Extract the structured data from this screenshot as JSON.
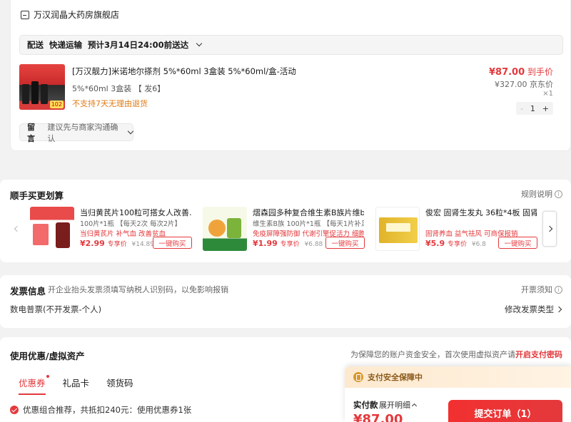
{
  "shop": {
    "name": "万汉润晶大药房旗舰店"
  },
  "shipping": {
    "label": "配送",
    "method": "快递运输",
    "eta": "预计3月14日24:00前送达"
  },
  "product": {
    "title": "[万汉靓力]米诺地尔搽剂 5%*60ml 3盒装 5%*60ml/盒-活动",
    "spec": "5%*60ml 3盒装 【 发6】",
    "return_policy": "不支持7天无理由退货",
    "price": "¥87.00",
    "price_suffix": "到手价",
    "jd_price": "¥327.00 京东价",
    "qty_x": "×1",
    "qty": "1",
    "image_tag": "102"
  },
  "memo": {
    "label": "留言",
    "placeholder": "建议先与商家沟通确认"
  },
  "bundle": {
    "title": "顺手买更划算",
    "rules": "规则说明",
    "items": [
      {
        "title": "当归黄芪片100粒可搭女人改善…",
        "sub": "100片*1瓶 【每天2次 每次2片】",
        "tag": "当归黄芪片 补气血 改善贫血",
        "price": "¥2.99",
        "price_label": "专享价",
        "orig": "¥14.89",
        "buy": "一键购买"
      },
      {
        "title": "熠森园多种复合维生素B族片维b…",
        "sub": "维生素B族 100片*1瓶 【每天1片补足B",
        "tag": "免疫屏障强防御 代谢引擎促活力 细胞修",
        "price": "¥1.99",
        "price_label": "专享价",
        "orig": "¥6.88",
        "buy": "一键购买"
      },
      {
        "title": "俊宏 固肾生发丸 36粒*4板 固肾…",
        "sub": "",
        "tag": "固肾养血 益气祛风 可商保报销",
        "price": "¥5.9",
        "price_label": "专享价",
        "orig": "¥6.8",
        "buy": "一键购买"
      }
    ]
  },
  "invoice": {
    "title": "发票信息",
    "hint": "开企业抬头发票须填写纳税人识别码，以免影响报销",
    "notice": "开票须知",
    "type": "数电普票(不开发票-个人)",
    "change": "修改发票类型"
  },
  "coupon": {
    "title": "使用优惠/虚拟资产",
    "note_prefix": "为保障您的账户资金安全，首次使用虚拟资产请",
    "note_link": "开启支付密码",
    "tabs": [
      "优惠券",
      "礼品卡",
      "领货码"
    ],
    "combo": "优惠组合推荐，共抵扣240元：使用优惠券1张"
  },
  "pay": {
    "safe": "支付安全保障中",
    "label": "实付款",
    "detail": "展开明细",
    "amount": "¥87.00",
    "submit": "提交订单（1）"
  },
  "colors": {
    "accent": "#e4393c",
    "warn": "#e07a15"
  }
}
